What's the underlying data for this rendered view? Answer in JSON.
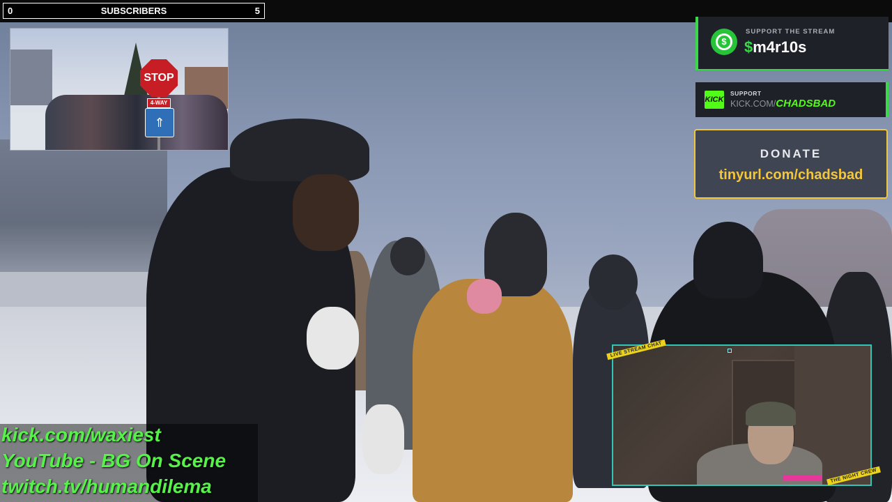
{
  "subscriber_bar": {
    "left_count": "0",
    "label": "SUBSCRIBERS",
    "right_count": "5"
  },
  "inset_video": {
    "stop_sign": "STOP",
    "way_plate": "4-WAY",
    "bus_sign": "⇑"
  },
  "support_stream": {
    "label": "SUPPORT THE STREAM",
    "dollar": "$",
    "handle": "m4r10s",
    "icon": "cash-app-icon"
  },
  "support_kick": {
    "label": "SUPPORT",
    "url_prefix": "KICK.COM/",
    "channel": "CHADSBAD",
    "logo_text": "KICK"
  },
  "donate": {
    "title": "DONATE",
    "url": "tinyurl.com/chadsbad"
  },
  "links": [
    "kick.com/waxiest",
    "YouTube - BG On Scene",
    "twitch.tv/humandilema"
  ],
  "webcam": {
    "tag_top": "LIVE STREAM CHAT",
    "tag_bottom": "THE NIGHT CREW"
  },
  "colors": {
    "accent_green": "#3ad84a",
    "kick_green": "#53fc18",
    "donate_gold": "#f0c840",
    "webcam_border": "#2fc6b7"
  }
}
